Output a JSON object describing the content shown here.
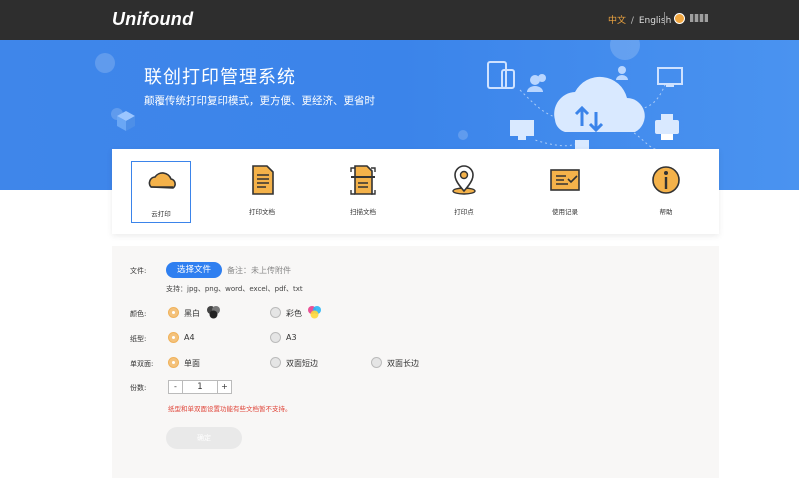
{
  "header": {
    "logo": "Unifound",
    "lang_cn": "中文",
    "lang_sep": "/",
    "lang_en": "English",
    "colors": {
      "bar": "#2e2e2e",
      "active_lang": "#f0a640"
    }
  },
  "banner": {
    "title": "联创打印管理系统",
    "subtitle": "颠覆传统打印复印模式，更方便、更经济、更省时",
    "color": "#3b84ea"
  },
  "nav": {
    "items": [
      {
        "label": "云打印",
        "icon": "cloud-print-icon",
        "active": true
      },
      {
        "label": "打印文档",
        "icon": "document-icon",
        "active": false
      },
      {
        "label": "扫描文档",
        "icon": "scan-document-icon",
        "active": false
      },
      {
        "label": "打印点",
        "icon": "location-pin-icon",
        "active": false
      },
      {
        "label": "使用记录",
        "icon": "usage-record-icon",
        "active": false
      },
      {
        "label": "帮助",
        "icon": "help-icon",
        "active": false
      }
    ]
  },
  "form": {
    "file_label": "文件:",
    "choose_button": "选择文件",
    "note": "备注：未上传附件",
    "support": "支持：jpg、png、word、excel、pdf、txt",
    "color_label": "颜色:",
    "color_options": [
      "黑白",
      "彩色"
    ],
    "paper_label": "纸型:",
    "paper_options": [
      "A4",
      "A3"
    ],
    "duplex_label": "单双面:",
    "duplex_options": [
      "单面",
      "双面短边",
      "双面长边"
    ],
    "copies_label": "份数:",
    "copies_minus": "-",
    "copies_value": "1",
    "copies_plus": "+",
    "warning": "纸型和单双面设置功能有些文档暂不支持。",
    "confirm_button": "确定",
    "accent": "#2f7ff0",
    "warning_color": "#e0463a"
  }
}
